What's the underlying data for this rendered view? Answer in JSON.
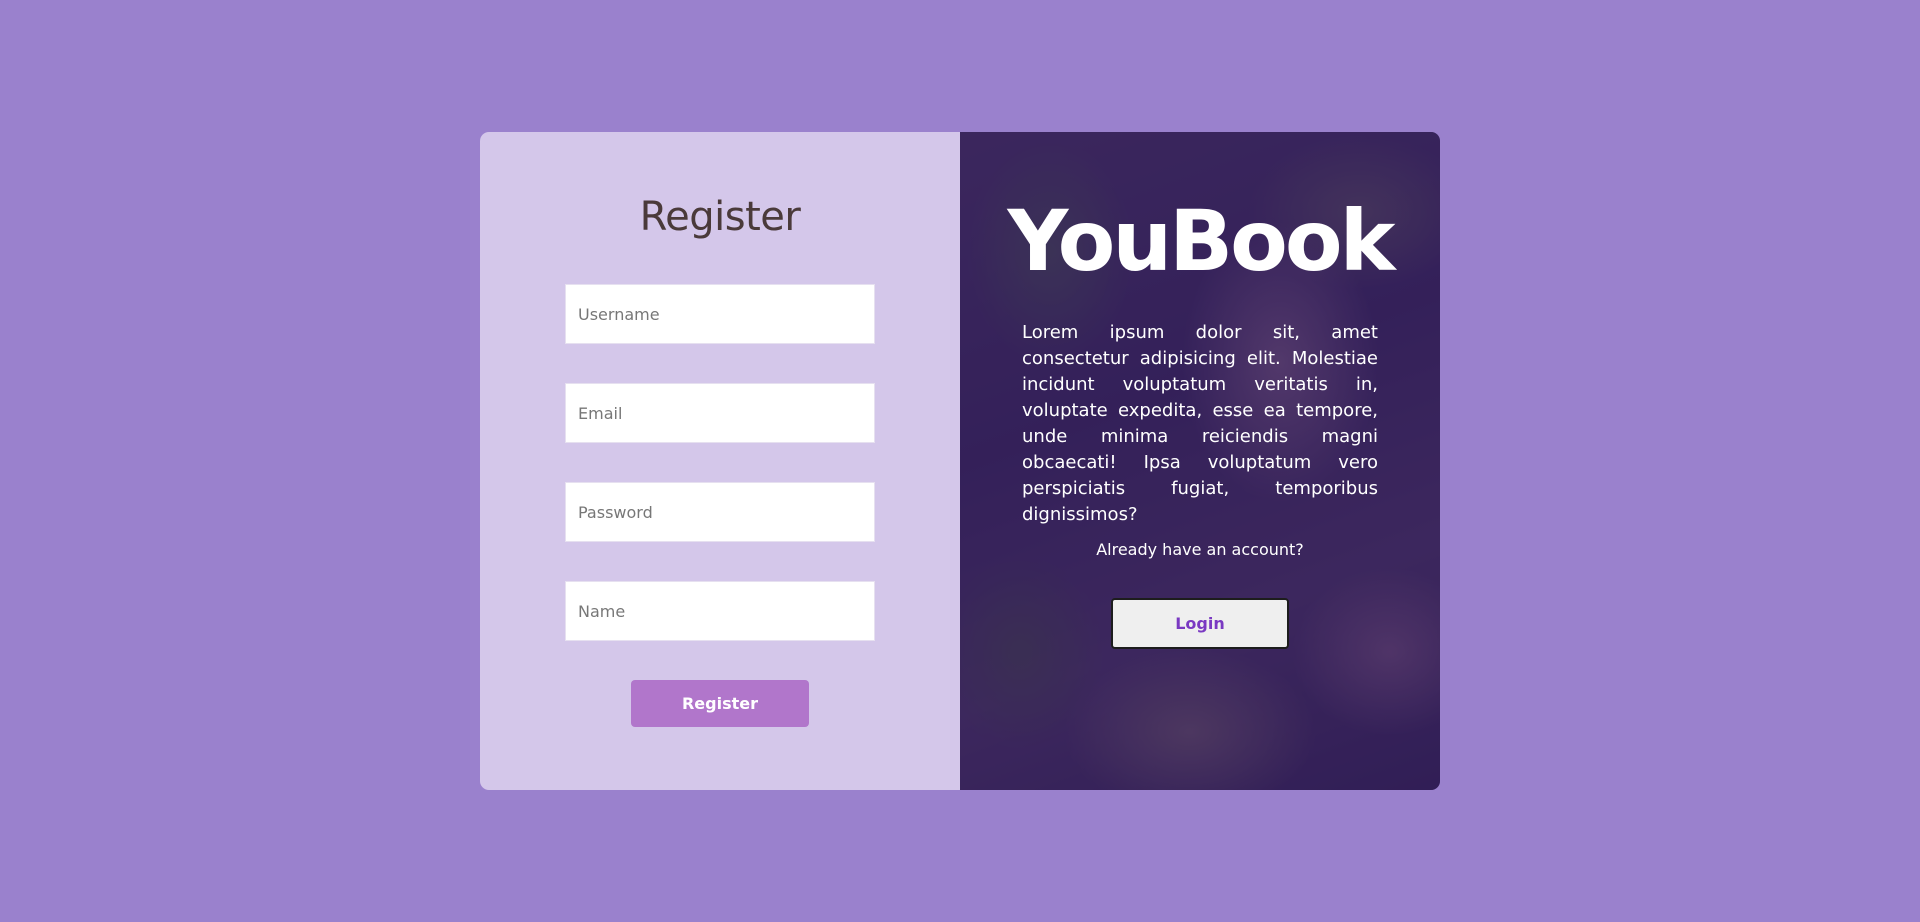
{
  "register": {
    "title": "Register",
    "fields": {
      "username_placeholder": "Username",
      "email_placeholder": "Email",
      "password_placeholder": "Password",
      "name_placeholder": "Name"
    },
    "button_label": "Register"
  },
  "brand": {
    "name": "YouBook",
    "description": "Lorem ipsum dolor sit, amet consectetur adipisicing elit. Molestiae incidunt voluptatum veritatis in, voluptate expedita, esse ea tempore, unde minima reiciendis magni obcaecati! Ipsa voluptatum vero perspiciatis fugiat, temporibus dignissimos?",
    "account_prompt": "Already have an account?",
    "login_label": "Login"
  },
  "colors": {
    "background": "#9a81cd",
    "form_panel": "#d4c7ea",
    "register_button": "#b176cb",
    "login_text": "#7a39c2"
  }
}
